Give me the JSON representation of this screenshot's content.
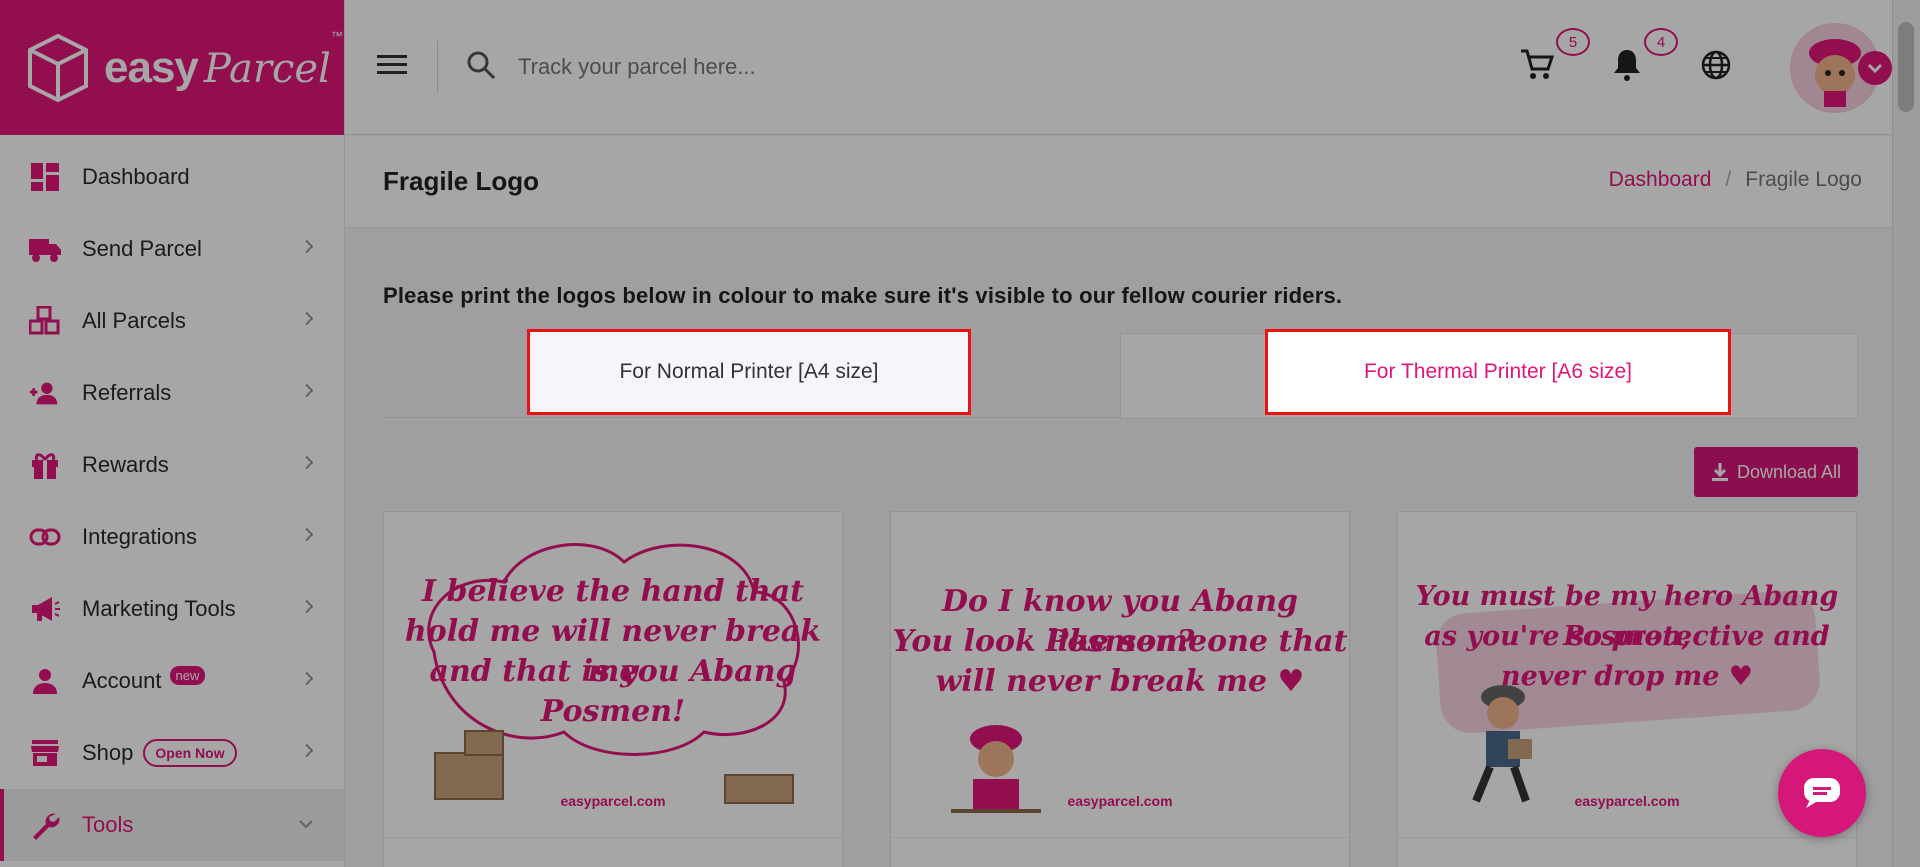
{
  "brand": {
    "word": "easy",
    "script": "Parcel",
    "tm": "™"
  },
  "sidebar": {
    "items": [
      {
        "label": "Dashboard",
        "icon": "dashboard-icon"
      },
      {
        "label": "Send Parcel",
        "icon": "truck-icon"
      },
      {
        "label": "All Parcels",
        "icon": "boxes-icon"
      },
      {
        "label": "Referrals",
        "icon": "user-plus-icon"
      },
      {
        "label": "Rewards",
        "icon": "gift-icon"
      },
      {
        "label": "Integrations",
        "icon": "link-icon"
      },
      {
        "label": "Marketing Tools",
        "icon": "megaphone-icon"
      },
      {
        "label": "Account",
        "icon": "person-icon",
        "badge": "new"
      },
      {
        "label": "Shop",
        "icon": "store-icon",
        "badge": "Open Now"
      },
      {
        "label": "Tools",
        "icon": "wrench-icon"
      }
    ]
  },
  "topbar": {
    "search_placeholder": "Track your parcel here...",
    "cart_count": "5",
    "notification_count": "4"
  },
  "page": {
    "title": "Fragile Logo",
    "breadcrumb": {
      "home": "Dashboard",
      "separator": "/",
      "current": "Fragile Logo"
    },
    "instruction": "Please print the logos below in colour to make sure it's visible to our fellow courier riders.",
    "tabs": {
      "a4": "For Normal Printer [A4 size]",
      "a6": "For Thermal Printer [A6 size]"
    },
    "download_all": "Download All"
  },
  "cards": [
    {
      "lines": [
        "I believe the hand that",
        "hold me will never break me",
        "and that is you Abang Posmen!"
      ],
      "site": "easyparcel.com"
    },
    {
      "lines": [
        "Do I know you Abang Posmen?",
        "You look like someone that",
        "will never break me ♥"
      ],
      "site": "easyparcel.com"
    },
    {
      "lines": [
        "You must be my hero Abang Posmen,",
        "as you're so protective and",
        "never drop me ♥"
      ],
      "site": "easyparcel.com"
    }
  ],
  "colors": {
    "brand": "#e1167a",
    "highlight": "#ee1111"
  }
}
